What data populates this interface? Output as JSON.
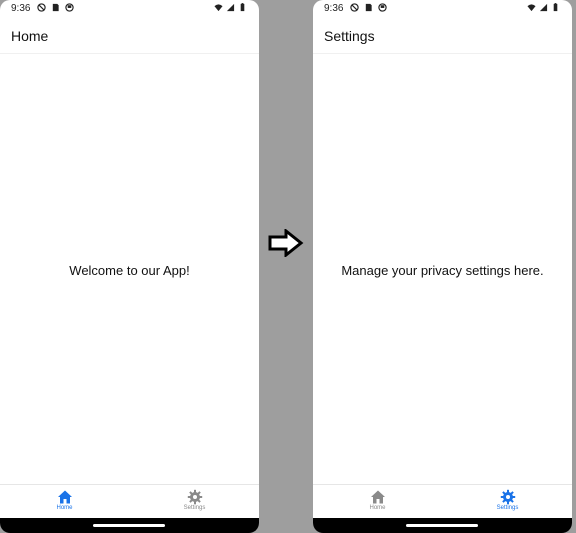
{
  "colors": {
    "background": "#9e9e9e",
    "accent": "#1a73e8",
    "inactive": "#8a8a8a"
  },
  "screens": [
    {
      "status_time": "9:36",
      "title": "Home",
      "message": "Welcome to our App!",
      "tabs": [
        {
          "label": "Home",
          "icon": "home-icon",
          "active": true
        },
        {
          "label": "Settings",
          "icon": "gear-icon",
          "active": false
        }
      ]
    },
    {
      "status_time": "9:36",
      "title": "Settings",
      "message": "Manage your privacy settings here.",
      "tabs": [
        {
          "label": "Home",
          "icon": "home-icon",
          "active": false
        },
        {
          "label": "Settings",
          "icon": "gear-icon",
          "active": true
        }
      ]
    }
  ],
  "transition_icon": "right-arrow-icon"
}
